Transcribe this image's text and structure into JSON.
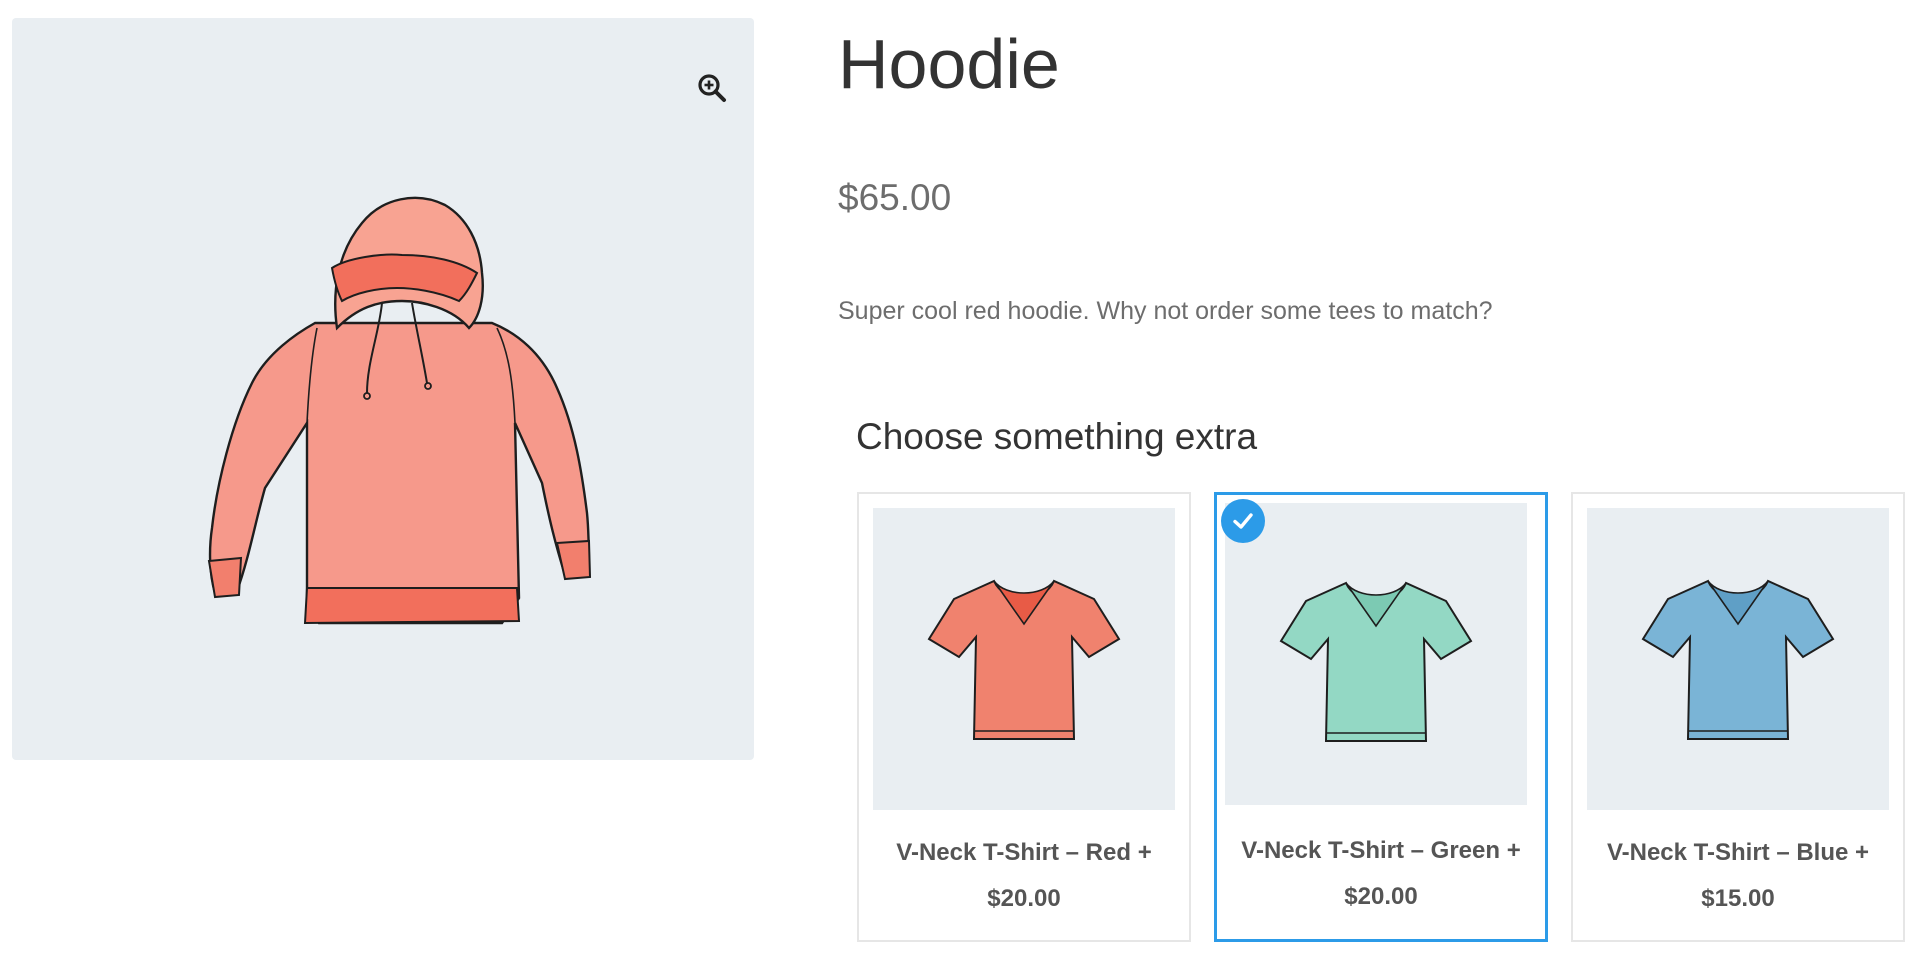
{
  "product": {
    "title": "Hoodie",
    "price": "$65.00",
    "description": "Super cool red hoodie. Why not order some tees to match?",
    "image_icon": "hoodie-illustration",
    "zoom_icon": "zoom-in-icon"
  },
  "extras": {
    "heading": "Choose something extra",
    "items": [
      {
        "name": "V-Neck T-Shirt – Red +",
        "price": "$20.00",
        "selected": false,
        "color": "#f0826e",
        "icon": "tshirt-red"
      },
      {
        "name": "V-Neck T-Shirt – Green +",
        "price": "$20.00",
        "selected": true,
        "color": "#93d8c4",
        "icon": "tshirt-green"
      },
      {
        "name": "V-Neck T-Shirt – Blue +",
        "price": "$15.00",
        "selected": false,
        "color": "#7ab4d6",
        "icon": "tshirt-blue"
      }
    ]
  },
  "colors": {
    "accent": "#2c9be8",
    "image_background": "#e9eef2",
    "hoodie": "#f58f80"
  }
}
